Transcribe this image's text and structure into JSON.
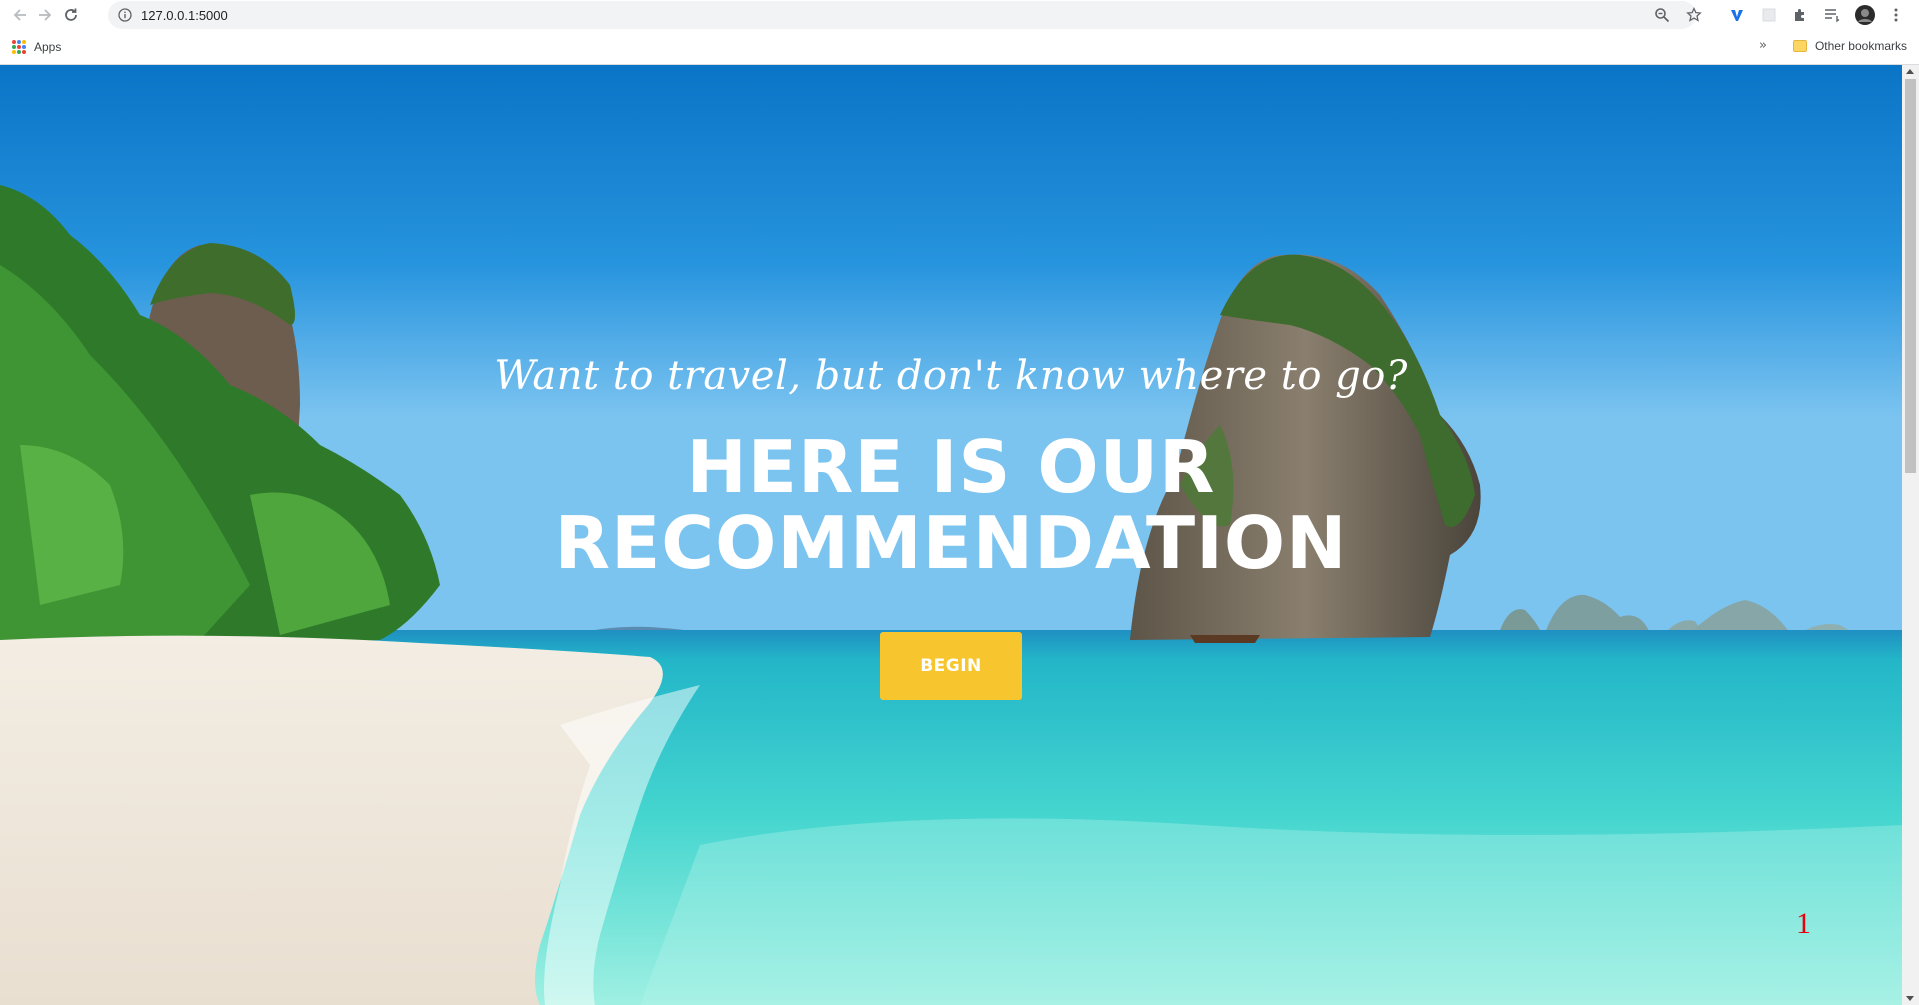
{
  "browser": {
    "url": "127.0.0.1:5000",
    "bookmarks_bar": {
      "apps_label": "Apps",
      "other_bookmarks_label": "Other bookmarks",
      "overflow_label": "»"
    },
    "extensions": [
      "zoom-icon",
      "star-icon",
      "v-extension-icon",
      "blank-extension-icon",
      "puzzle-icon",
      "reading-list-icon",
      "avatar",
      "menu-icon"
    ]
  },
  "hero": {
    "tagline": "Want to travel, but don't know where to go?",
    "headline_line1": "HERE IS OUR",
    "headline_line2": "RECOMMENDATION",
    "begin_label": "BEGIN",
    "page_number": "1"
  },
  "colors": {
    "button": "#f7c62f",
    "page_number": "#e8000a",
    "sky_top": "#0a78c8",
    "sea": "#3fd3cc",
    "sand": "#efe8dc"
  }
}
